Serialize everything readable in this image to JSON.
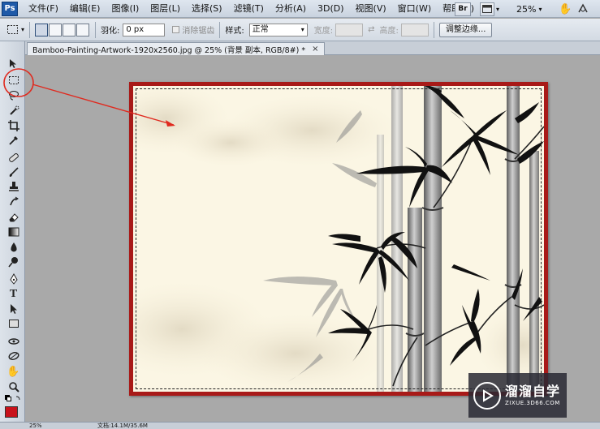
{
  "app": {
    "logo": "Ps"
  },
  "menu": [
    "文件(F)",
    "编辑(E)",
    "图像(I)",
    "图层(L)",
    "选择(S)",
    "滤镜(T)",
    "分析(A)",
    "3D(D)",
    "视图(V)",
    "窗口(W)",
    "帮助(H)"
  ],
  "menubar_right": {
    "bridge": "Br",
    "zoom": "25%"
  },
  "options": {
    "feather_label": "羽化:",
    "feather_value": "0 px",
    "antialias_label": "消除锯齿",
    "style_label": "样式:",
    "style_value": "正常",
    "width_label": "宽度:",
    "height_label": "高度:",
    "refine_edge": "调整边缘..."
  },
  "document": {
    "tab_title": "Bamboo-Painting-Artwork-1920x2560.jpg @ 25% (背景 副本, RGB/8#) *",
    "close": "×"
  },
  "status": {
    "zoom": "25%",
    "doc_info": "文档:14.1M/35.6M"
  },
  "colors": {
    "accent_red": "#a81a18",
    "annotation_red": "#e02a1f",
    "foreground_swatch": "#c8121b"
  },
  "watermark": {
    "title": "溜溜自学",
    "url": "ZIXUE.3D66.COM"
  }
}
